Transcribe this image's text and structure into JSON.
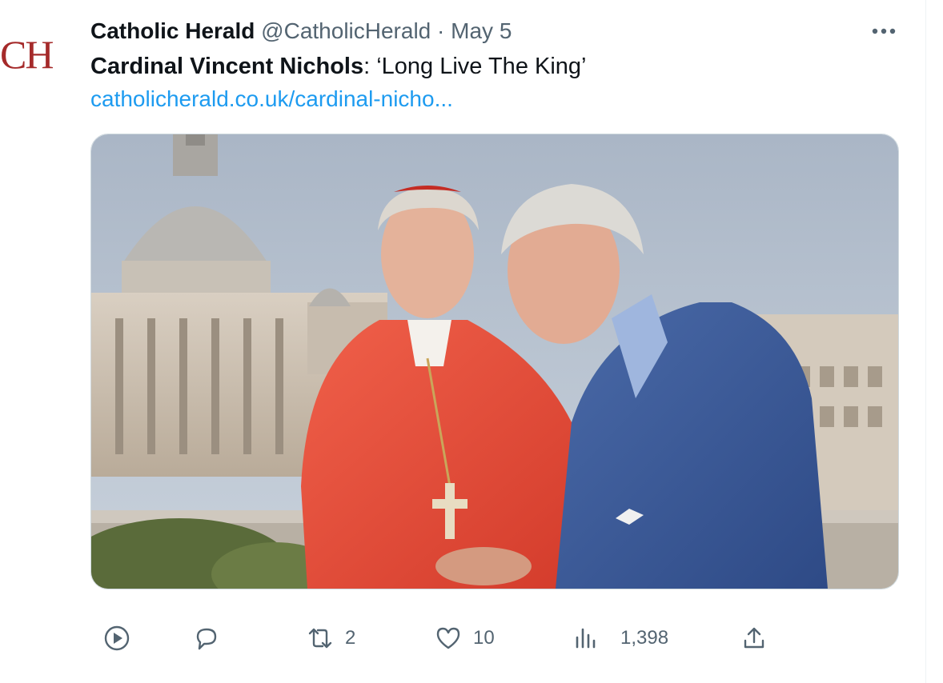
{
  "tweet": {
    "avatar_text": "CH",
    "author_name": "Catholic Herald",
    "handle": "@CatholicHerald",
    "separator": "·",
    "date": "May 5",
    "text_bold": "Cardinal Vincent Nichols",
    "text_rest": ": ‘Long Live The King’",
    "link": "catholicherald.co.uk/cardinal-nicho..."
  },
  "actions": {
    "play": {
      "icon": "play-circle-icon"
    },
    "reply": {
      "icon": "reply-icon"
    },
    "retweet": {
      "icon": "retweet-icon",
      "count": "2"
    },
    "like": {
      "icon": "heart-icon",
      "count": "10"
    },
    "views": {
      "icon": "analytics-icon",
      "count": "1,398"
    },
    "share": {
      "icon": "share-icon"
    }
  },
  "colors": {
    "link": "#1d9bf0",
    "muted": "#536471",
    "text": "#0f1419",
    "avatar": "#a52a2a"
  }
}
